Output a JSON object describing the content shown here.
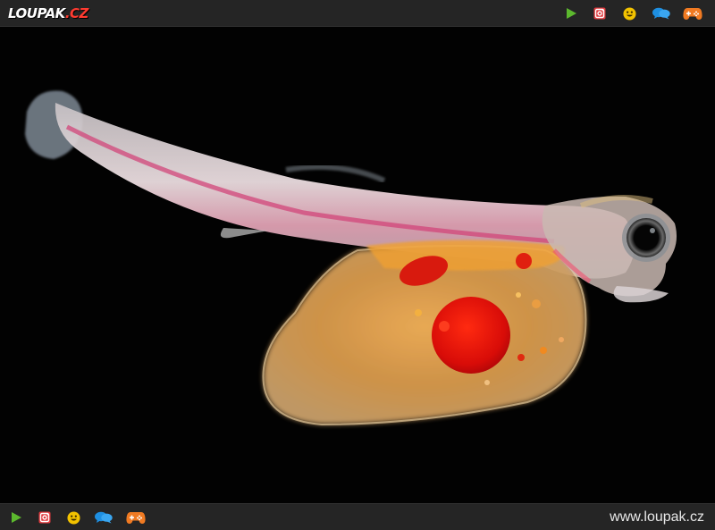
{
  "header": {
    "logo_main": "LOUPAK",
    "logo_tld": ".CZ"
  },
  "toolbar_icons": [
    {
      "name": "play-icon",
      "color": "#5cb82e"
    },
    {
      "name": "instagram-icon",
      "color": "#e03a3e"
    },
    {
      "name": "smiley-icon",
      "color": "#f2c200"
    },
    {
      "name": "chat-icon",
      "color": "#1e8fe1"
    },
    {
      "name": "gamepad-icon",
      "color": "#f07a22"
    }
  ],
  "footer": {
    "url": "www.loupak.cz"
  },
  "colors": {
    "bar_background": "#252525",
    "photo_background": "#000000"
  }
}
